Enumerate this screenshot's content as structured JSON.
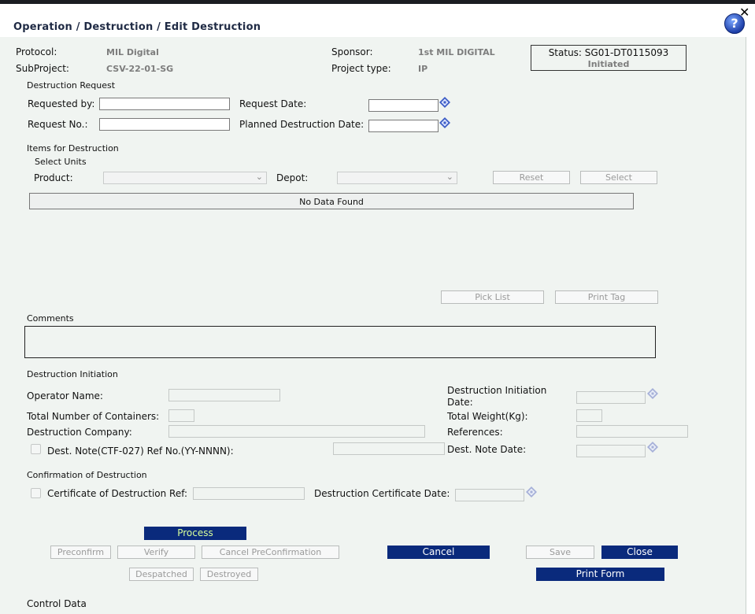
{
  "window": {
    "breadcrumb": "Operation / Destruction / Edit Destruction",
    "help_glyph": "?",
    "close_glyph": "✕"
  },
  "header": {
    "protocol_label": "Protocol:",
    "protocol_value": "MIL Digital",
    "subproject_label": "SubProject:",
    "subproject_value": "CSV-22-01-SG",
    "sponsor_label": "Sponsor:",
    "sponsor_value": "1st MIL DIGITAL",
    "project_type_label": "Project type:",
    "project_type_value": "IP",
    "status_line1": "Status: SG01-DT0115093",
    "status_line2": "Initiated"
  },
  "destruction_request": {
    "section_title": "Destruction Request",
    "requested_by_label": "Requested by:",
    "requested_by_value": "",
    "request_date_label": "Request Date:",
    "request_date_value": "",
    "request_no_label": "Request No.:",
    "request_no_value": "",
    "planned_date_label": "Planned Destruction Date:",
    "planned_date_value": ""
  },
  "items": {
    "section_title": "Items for Destruction",
    "select_units_label": "Select Units",
    "product_label": "Product:",
    "product_value": "",
    "depot_label": "Depot:",
    "depot_value": "",
    "reset_label": "Reset",
    "select_label": "Select",
    "no_data": "No Data Found",
    "pick_list_label": "Pick List",
    "print_tag_label": "Print Tag"
  },
  "comments": {
    "section_title": "Comments",
    "value": ""
  },
  "initiation": {
    "section_title": "Destruction Initiation",
    "operator_label": "Operator Name:",
    "containers_label": "Total Number of Containers:",
    "company_label": "Destruction Company:",
    "dest_note_label": "Dest. Note(CTF-027) Ref No.(YY-NNNN):",
    "init_date_label_1": "Destruction Initiation",
    "init_date_label_2": "Date:",
    "weight_label": "Total Weight(Kg):",
    "references_label": "References:",
    "dest_note_date_label": "Dest. Note Date:"
  },
  "confirmation": {
    "section_title": "Confirmation of Destruction",
    "certificate_ref_label": "Certificate of Destruction Ref:",
    "certificate_date_label": "Destruction Certificate Date:"
  },
  "actions": {
    "process": "Process",
    "preconfirm": "Preconfirm",
    "verify": "Verify",
    "cancel_preconfirmation": "Cancel PreConfirmation",
    "cancel": "Cancel",
    "save": "Save",
    "close": "Close",
    "despatched": "Despatched",
    "destroyed": "Destroyed",
    "print_form": "Print Form"
  },
  "footer": {
    "control_data": "Control Data"
  },
  "colors": {
    "panel_bg": "#f0f4f1",
    "primary_button": "#0a2a7c",
    "process_text": "#d8ff9a",
    "title_text": "#1f2a44"
  }
}
